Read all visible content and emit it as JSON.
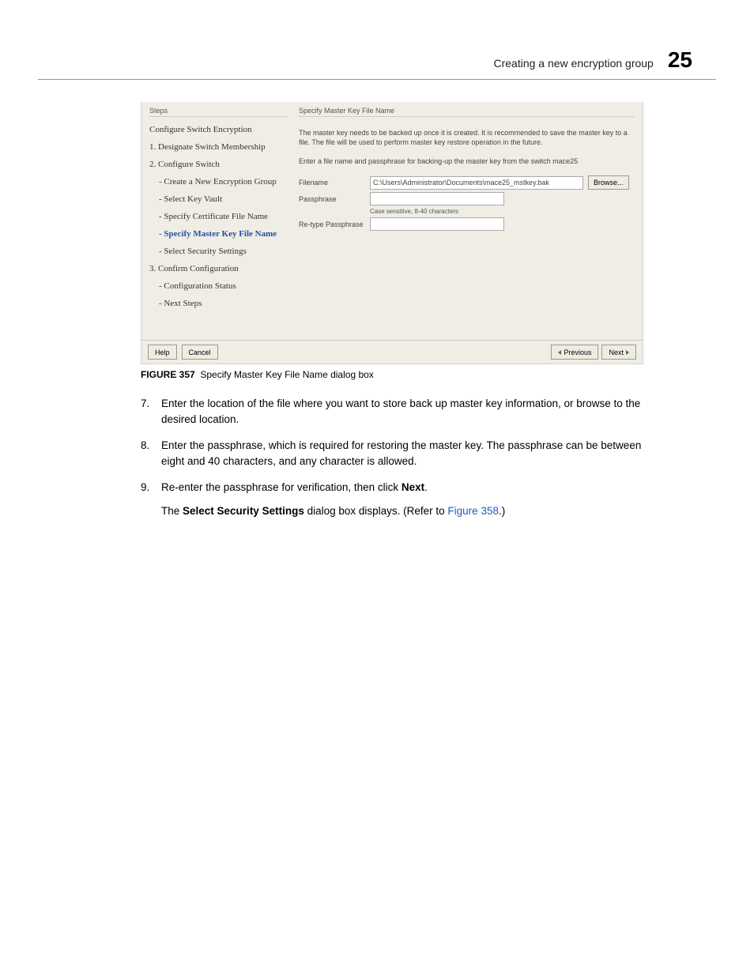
{
  "header": {
    "title": "Creating a new encryption group",
    "chapter": "25"
  },
  "dialog": {
    "steps_label": "Steps",
    "panel_title": "Specify Master Key File Name",
    "steps": {
      "s0": "Configure Switch Encryption",
      "s1": "1. Designate Switch Membership",
      "s2": "2. Configure Switch",
      "s2a": "- Create a New Encryption Group",
      "s2b": "- Select Key Vault",
      "s2c": "- Specify Certificate File Name",
      "s2d": "- Specify Master Key File Name",
      "s2e": "- Select Security Settings",
      "s3": "3. Confirm Configuration",
      "s3a": "- Configuration Status",
      "s3b": "- Next Steps"
    },
    "desc1": "The master key needs to be backed up once it is created. It is recommended to save the master key to a file. The file will be used to perform master key restore operation in the future.",
    "desc2": "Enter a file name and passphrase for backing-up the master key from the switch mace25",
    "labels": {
      "filename": "Filename",
      "passphrase": "Passphrase",
      "retype": "Re-type Passphrase"
    },
    "filename_value": "C:\\Users\\Administrator\\Documents\\mace25_mstkey.bak",
    "pass_hint": "Case sensitive, 8-40 characters",
    "buttons": {
      "browse": "Browse...",
      "help": "Help",
      "cancel": "Cancel",
      "previous": "Previous",
      "next": "Next"
    }
  },
  "caption": {
    "label": "FIGURE 357",
    "text": "Specify Master Key File Name dialog box"
  },
  "body": {
    "i7": {
      "num": "7.",
      "text": "Enter the location of the file where you want to store back up master key information, or browse to the desired location."
    },
    "i8": {
      "num": "8.",
      "text": "Enter the passphrase, which is required for restoring the master key. The passphrase can be between eight and 40 characters, and any character is allowed."
    },
    "i9": {
      "num": "9.",
      "text_a": "Re-enter the passphrase for verification, then click ",
      "next_bold": "Next",
      "text_b": ".",
      "sub_a": "The ",
      "sub_bold": "Select Security Settings",
      "sub_b": " dialog box displays. (Refer to ",
      "sub_link": "Figure 358",
      "sub_c": ".)"
    }
  }
}
